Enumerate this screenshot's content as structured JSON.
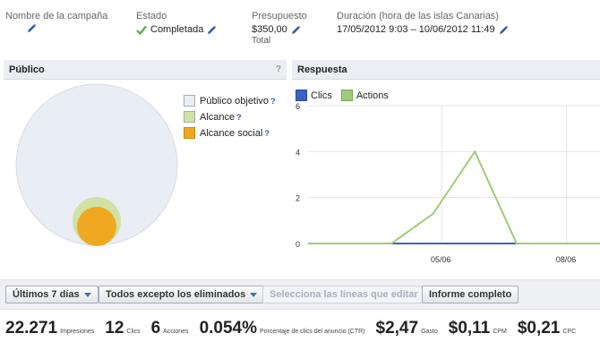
{
  "header": {
    "campaign_name_label": "Nombre de la campaña",
    "status_label": "Estado",
    "status_value": "Completada",
    "budget_label": "Presupuesto",
    "budget_value": "$350,00",
    "budget_sub": "Total",
    "duration_label": "Duración (hora de las islas Canarias)",
    "duration_value": "17/05/2012 9:03 – 10/06/2012 11:49"
  },
  "audience_panel": {
    "title": "Público",
    "help": "?",
    "legend": [
      {
        "label": "Público objetivo",
        "help": "?",
        "color": "#e9edf4"
      },
      {
        "label": "Alcance",
        "help": "?",
        "color": "#cfe3a6"
      },
      {
        "label": "Alcance social",
        "help": "?",
        "color": "#f0a821"
      }
    ]
  },
  "response_panel": {
    "title": "Respuesta"
  },
  "chart_data": {
    "type": "line",
    "series": [
      {
        "name": "Clics",
        "color": "#3b62c4",
        "values": [
          0,
          0,
          0,
          0,
          0,
          0,
          0,
          0
        ]
      },
      {
        "name": "Actions",
        "color": "#a4c97a",
        "values": [
          0,
          0,
          0,
          1.3,
          4,
          0,
          0,
          0
        ]
      }
    ],
    "x_tick_labels": [
      "05/06",
      "08/06"
    ],
    "y_tick_labels": [
      "0",
      "2",
      "4",
      "6"
    ],
    "ylim": [
      0,
      6
    ]
  },
  "toolbar": {
    "period_label": "Últimos 7 días",
    "filter_label": "Todos excepto los eliminados",
    "select_lines_label": "Selecciona las líneas que editar",
    "report_label": "Informe completo"
  },
  "stats": [
    {
      "value": "22.271",
      "label": "Impresiones"
    },
    {
      "value": "12",
      "label": "Clics"
    },
    {
      "value": "6",
      "label": "Acciones"
    },
    {
      "value": "0.054%",
      "label": "Porcentaje de clics del anuncio (CTR)"
    },
    {
      "value": "$2,47",
      "label": "Gasto"
    },
    {
      "value": "$0,11",
      "label": "CPM"
    },
    {
      "value": "$0,21",
      "label": "CPC"
    }
  ]
}
